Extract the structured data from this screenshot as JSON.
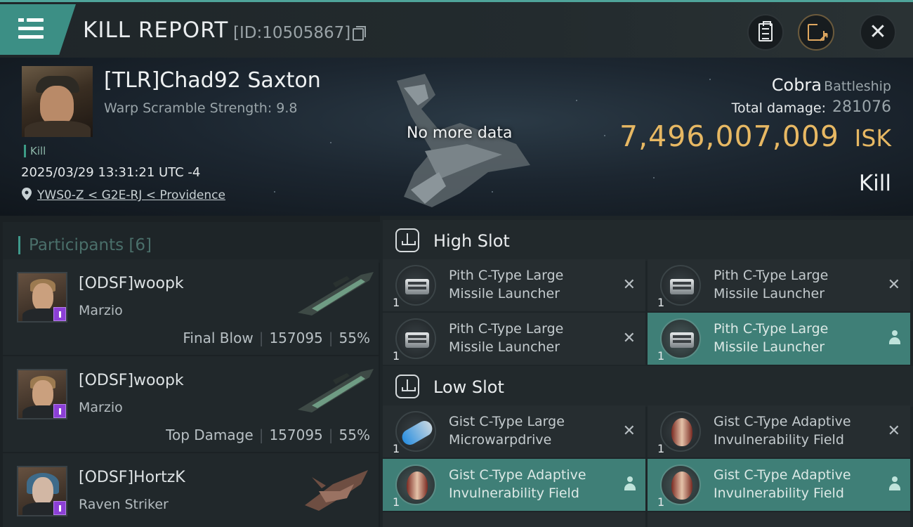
{
  "header": {
    "title": "KILL REPORT",
    "report_id": "[ID:10505867]",
    "menu_icon": "hamburger-menu-icon",
    "actions": [
      "clipboard-icon",
      "share-icon",
      "close-icon"
    ]
  },
  "victim": {
    "name": "[TLR]Chad92 Saxton",
    "warp_scramble": "Warp Scramble Strength: 9.8",
    "kill_tag": "Kill",
    "time": "2025/03/29 13:31:21 UTC -4",
    "location": "YWS0-Z < G2E-RJ < Providence",
    "ship_overlay": "No more data",
    "ship_name": "Cobra",
    "ship_class": "Battleship",
    "total_damage_label": "Total damage:",
    "total_damage": "281076",
    "isk_value": "7,496,007,009",
    "isk_unit": "ISK",
    "result": "Kill"
  },
  "participants": {
    "title": "Participants",
    "count": "[6]",
    "rows": [
      {
        "name": "[ODSF]woopk",
        "ship": "Marzio",
        "role": "Final Blow",
        "damage": "157095",
        "percent": "55%"
      },
      {
        "name": "[ODSF]woopk",
        "ship": "Marzio",
        "role": "Top Damage",
        "damage": "157095",
        "percent": "55%"
      },
      {
        "name": "[ODSF]HortzK",
        "ship": "Raven Striker",
        "role": "",
        "damage": "",
        "percent": ""
      }
    ]
  },
  "fitting": {
    "high_slot_label": "High Slot",
    "low_slot_label": "Low Slot",
    "items": [
      {
        "name_line1": "Pith C-Type Large",
        "name_line2": "Missile Launcher",
        "qty": "1",
        "status": "destroyed"
      },
      {
        "name_line1": "Pith C-Type Large",
        "name_line2": "Missile Launcher",
        "qty": "1",
        "status": "destroyed"
      },
      {
        "name_line1": "Pith C-Type Large",
        "name_line2": "Missile Launcher",
        "qty": "1",
        "status": "destroyed"
      },
      {
        "name_line1": "Pith C-Type Large",
        "name_line2": "Missile Launcher",
        "qty": "1",
        "status": "dropped"
      },
      {
        "name_line1": "Gist C-Type Large",
        "name_line2": "Microwarpdrive",
        "qty": "1",
        "status": "destroyed"
      },
      {
        "name_line1": "Gist C-Type Adaptive",
        "name_line2": "Invulnerability Field",
        "qty": "1",
        "status": "destroyed"
      },
      {
        "name_line1": "Gist C-Type Adaptive",
        "name_line2": "Invulnerability Field",
        "qty": "1",
        "status": "dropped"
      },
      {
        "name_line1": "Gist C-Type Adaptive",
        "name_line2": "Invulnerability Field",
        "qty": "1",
        "status": "dropped"
      }
    ],
    "destroyed_mark": "✕"
  },
  "colors": {
    "accent": "#3c8f85",
    "isk": "#e7b863",
    "dropped_bg": "#3f7f77"
  }
}
